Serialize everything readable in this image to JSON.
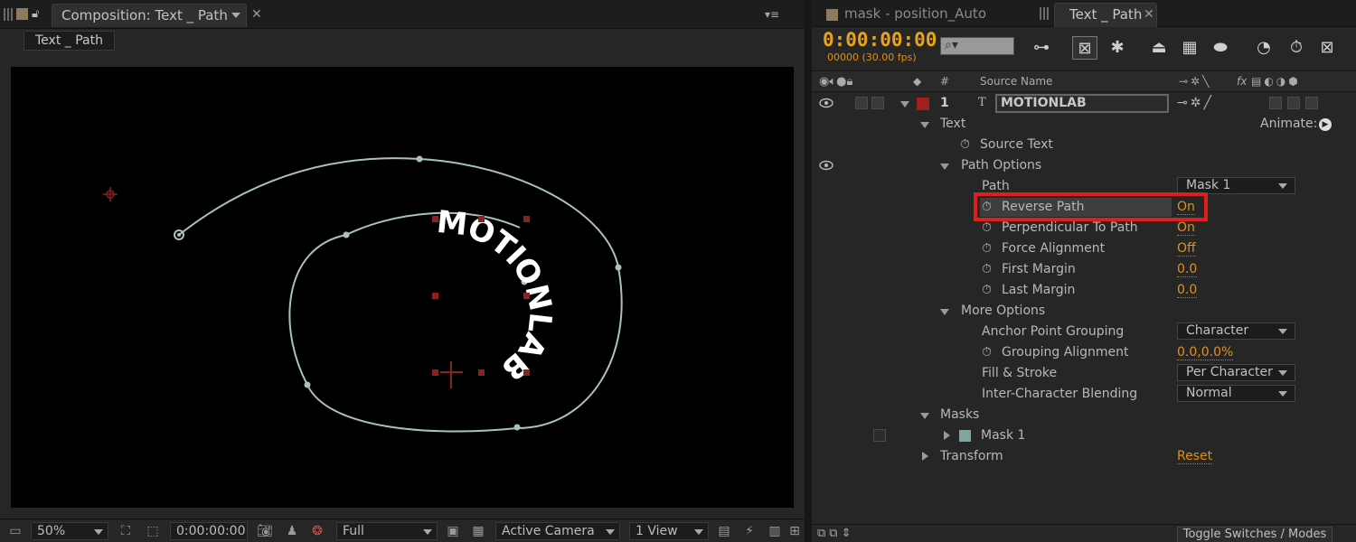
{
  "composition": {
    "tab_title": "Composition: Text _ Path",
    "subtab": "Text _ Path",
    "text_on_path": "MOTIONLAB",
    "footer": {
      "zoom": "50%",
      "timecode": "0:00:00:00",
      "resolution": "Full",
      "camera": "Active Camera",
      "views": "1 View"
    }
  },
  "timeline": {
    "tabs": [
      {
        "label": "mask - position_Auto Orient",
        "active": false
      },
      {
        "label": "Text _ Path",
        "active": true
      }
    ],
    "timecode": "0:00:00:00",
    "fps": "00000 (30.00 fps)",
    "header": {
      "number": "#",
      "source_name": "Source Name",
      "fx": "fx"
    },
    "layer": {
      "index": "1",
      "name": "MOTIONLAB",
      "type_icon": "T"
    },
    "rows": {
      "text": "Text",
      "animate": "Animate:",
      "source_text": "Source Text",
      "path_options": "Path Options",
      "path": "Path",
      "path_value": "Mask 1",
      "reverse_path": "Reverse Path",
      "reverse_path_value": "On",
      "perpendicular": "Perpendicular To Path",
      "perpendicular_value": "On",
      "force_alignment": "Force Alignment",
      "force_alignment_value": "Off",
      "first_margin": "First Margin",
      "first_margin_value": "0.0",
      "last_margin": "Last Margin",
      "last_margin_value": "0.0",
      "more_options": "More Options",
      "anchor_grouping": "Anchor Point Grouping",
      "anchor_grouping_value": "Character",
      "grouping_alignment": "Grouping Alignment",
      "grouping_alignment_value": "0.0,0.0%",
      "fill_stroke": "Fill & Stroke",
      "fill_stroke_value": "Per Character",
      "blending": "Inter-Character Blending",
      "blending_value": "Normal",
      "masks": "Masks",
      "mask1": "Mask 1",
      "transform": "Transform",
      "transform_value": "Reset"
    },
    "toggle_switches": "Toggle Switches / Modes"
  },
  "colors": {
    "timecode": "#e8a21c",
    "value": "#e0901a",
    "highlight": "#e01e1e",
    "label_red": "#a31f1f",
    "mask_swatch": "#7fa6a0"
  }
}
